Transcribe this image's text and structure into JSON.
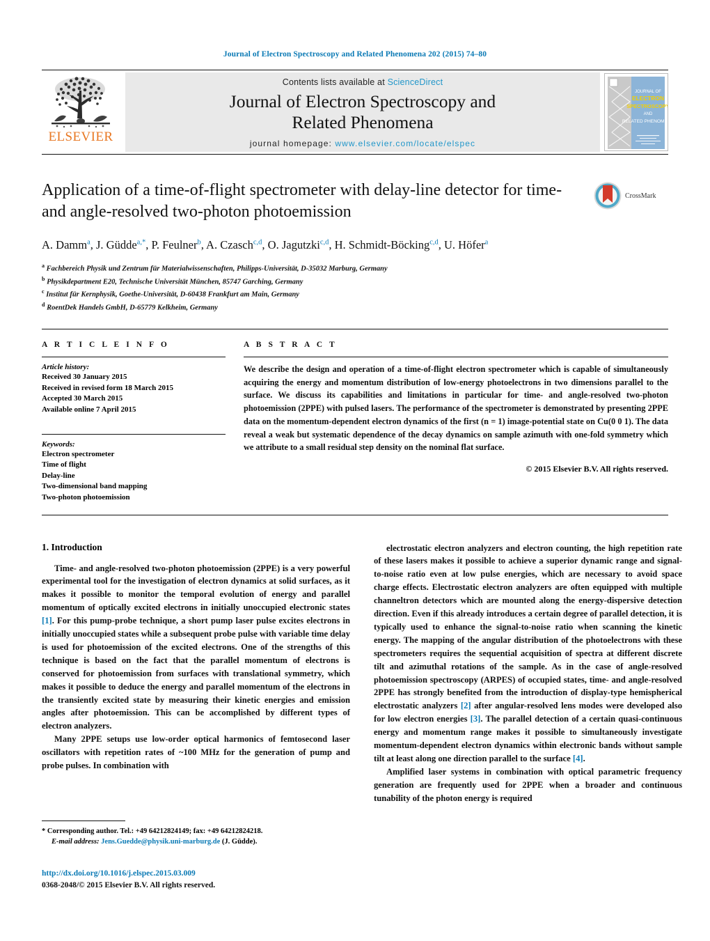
{
  "running_head": "Journal of Electron Spectroscopy and Related Phenomena 202 (2015) 74–80",
  "colors": {
    "link_blue": "#0b7ab5",
    "sciencedirect_blue": "#2196c9",
    "elsevier_orange": "#E87722",
    "masthead_grey": "#e9e9e9"
  },
  "masthead": {
    "publisher_name": "ELSEVIER",
    "publisher_logo": "elsevier-tree-logo",
    "contents_prefix": "Contents lists available at",
    "contents_link": "ScienceDirect",
    "journal_title_line1": "Journal of Electron Spectroscopy and",
    "journal_title_line2": "Related Phenomena",
    "homepage_label": "journal homepage:",
    "homepage_url": "www.elsevier.com/locate/elspec",
    "cover_thumb": {
      "line1": "JOURNAL OF",
      "line2": "ELECTRON",
      "line3": "SPECTROSCOPY",
      "line4": "AND",
      "line5": "RELATED PHENOMENA"
    }
  },
  "article": {
    "title": "Application of a time-of-flight spectrometer with delay-line detector for time- and angle-resolved two-photon photoemission",
    "crossmark_label": "CrossMark",
    "authors_html": "A. Damm<sup>a</sup>, J. Güdde<sup>a,*</sup>, P. Feulner<sup>b</sup>, A. Czasch<sup>c,d</sup>, O. Jagutzki<sup>c,d</sup>, H. Schmidt-Böcking<sup>c,d</sup>, U. Höfer<sup>a</sup>",
    "affiliations": [
      {
        "marker": "a",
        "text": "Fachbereich Physik und Zentrum für Materialwissenschaften, Philipps-Universität, D-35032 Marburg, Germany"
      },
      {
        "marker": "b",
        "text": "Physikdepartment E20, Technische Universität München, 85747 Garching, Germany"
      },
      {
        "marker": "c",
        "text": "Institut für Kernphysik, Goethe-Universität, D-60438 Frankfurt am Main, Germany"
      },
      {
        "marker": "d",
        "text": "RoentDek Handels GmbH, D-65779 Kelkheim, Germany"
      }
    ]
  },
  "article_info": {
    "heading": "A R T I C L E   I N F O",
    "history_label": "Article history:",
    "history": [
      "Received 30 January 2015",
      "Received in revised form 18 March 2015",
      "Accepted 30 March 2015",
      "Available online 7 April 2015"
    ],
    "keywords_label": "Keywords:",
    "keywords": [
      "Electron spectrometer",
      "Time of flight",
      "Delay-line",
      "Two-dimensional band mapping",
      "Two-photon photoemission"
    ]
  },
  "abstract": {
    "heading": "A B S T R A C T",
    "text": "We describe the design and operation of a time-of-flight electron spectrometer which is capable of simultaneously acquiring the energy and momentum distribution of low-energy photoelectrons in two dimensions parallel to the surface. We discuss its capabilities and limitations in particular for time- and angle-resolved two-photon photoemission (2PPE) with pulsed lasers. The performance of the spectrometer is demonstrated by presenting 2PPE data on the momentum-dependent electron dynamics of the first (n = 1) image-potential state on Cu(0 0 1). The data reveal a weak but systematic dependence of the decay dynamics on sample azimuth with one-fold symmetry which we attribute to a small residual step density on the nominal flat surface.",
    "rights": "© 2015 Elsevier B.V. All rights reserved."
  },
  "body": {
    "section_number_title": "1.  Introduction",
    "left_paragraphs": [
      "Time- and angle-resolved two-photon photoemission (2PPE) is a very powerful experimental tool for the investigation of electron dynamics at solid surfaces, as it makes it possible to monitor the temporal evolution of energy and parallel momentum of optically excited electrons in initially unoccupied electronic states [1]. For this pump-probe technique, a short pump laser pulse excites electrons in initially unoccupied states while a subsequent probe pulse with variable time delay is used for photoemission of the excited electrons. One of the strengths of this technique is based on the fact that the parallel momentum of electrons is conserved for photoemission from surfaces with translational symmetry, which makes it possible to deduce the energy and parallel momentum of the electrons in the transiently excited state by measuring their kinetic energies and emission angles after photoemission. This can be accomplished by different types of electron analyzers.",
      "Many 2PPE setups use low-order optical harmonics of femtosecond laser oscillators with repetition rates of ~100 MHz for the generation of pump and probe pulses. In combination with"
    ],
    "right_paragraphs": [
      "electrostatic electron analyzers and electron counting, the high repetition rate of these lasers makes it possible to achieve a superior dynamic range and signal-to-noise ratio even at low pulse energies, which are necessary to avoid space charge effects. Electrostatic electron analyzers are often equipped with multiple channeltron detectors which are mounted along the energy-dispersive detection direction. Even if this already introduces a certain degree of parallel detection, it is typically used to enhance the signal-to-noise ratio when scanning the kinetic energy. The mapping of the angular distribution of the photoelectrons with these spectrometers requires the sequential acquisition of spectra at different discrete tilt and azimuthal rotations of the sample. As in the case of angle-resolved photoemission spectroscopy (ARPES) of occupied states, time- and angle-resolved 2PPE has strongly benefited from the introduction of display-type hemispherical electrostatic analyzers [2] after angular-resolved lens modes were developed also for low electron energies [3]. The parallel detection of a certain quasi-continuous energy and momentum range makes it possible to simultaneously investigate momentum-dependent electron dynamics within electronic bands without sample tilt at least along one direction parallel to the surface [4].",
      "Amplified laser systems in combination with optical parametric frequency generation are frequently used for 2PPE when a broader and continuous tunability of the photon energy is required"
    ]
  },
  "footnote": {
    "corresponding_marker": "*",
    "corresponding_text": "Corresponding author. Tel.: +49 64212824149; fax: +49 64212824218.",
    "email_label": "E-mail address:",
    "email": "Jens.Guedde@physik.uni-marburg.de",
    "email_owner": "(J. Güdde)."
  },
  "publication_footer": {
    "doi": "http://dx.doi.org/10.1016/j.elspec.2015.03.009",
    "issn_rights": "0368-2048/© 2015 Elsevier B.V. All rights reserved."
  }
}
